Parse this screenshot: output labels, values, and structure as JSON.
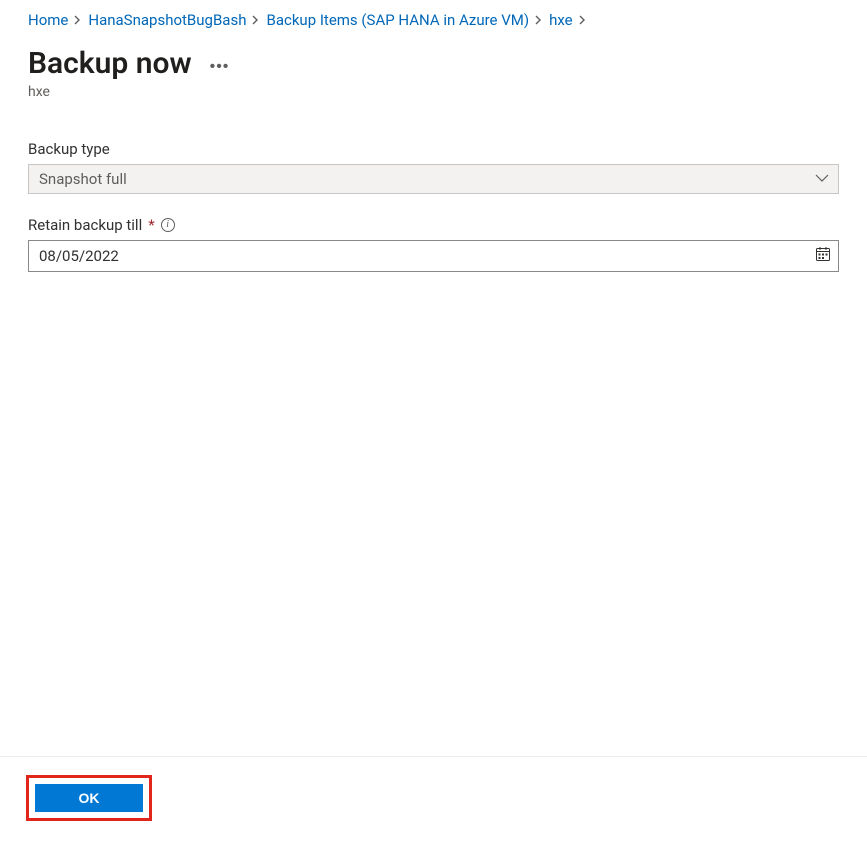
{
  "breadcrumb": {
    "items": [
      {
        "label": "Home"
      },
      {
        "label": "HanaSnapshotBugBash"
      },
      {
        "label": "Backup Items (SAP HANA in Azure VM)"
      },
      {
        "label": "hxe"
      }
    ]
  },
  "header": {
    "title": "Backup now",
    "subtitle": "hxe"
  },
  "form": {
    "backup_type_label": "Backup type",
    "backup_type_value": "Snapshot full",
    "retain_label": "Retain backup till",
    "retain_value": "08/05/2022"
  },
  "footer": {
    "ok_label": "OK"
  }
}
